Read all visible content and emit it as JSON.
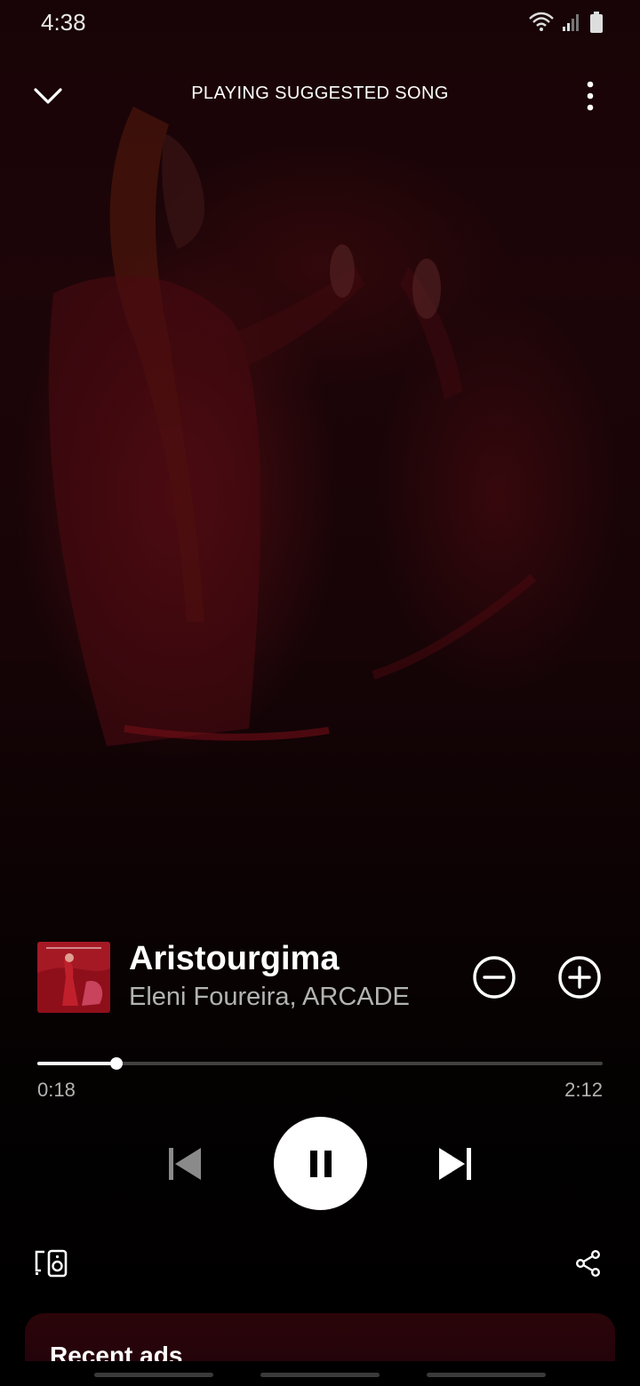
{
  "status_bar": {
    "time": "4:38",
    "icons": [
      "wifi-icon",
      "signal-icon",
      "battery-icon"
    ]
  },
  "header": {
    "title": "PLAYING SUGGESTED SONG",
    "collapse_icon": "chevron-down-icon",
    "more_icon": "more-vertical-icon"
  },
  "track": {
    "title": "Aristourgima",
    "artist": "Eleni Foureira, ARCADE"
  },
  "playback": {
    "elapsed": "0:18",
    "total": "2:12",
    "progress_fraction": 0.14,
    "is_playing": true
  },
  "controls": {
    "remove_icon": "minus-circle-icon",
    "add_icon": "plus-circle-icon",
    "prev_icon": "skip-previous-icon",
    "play_pause_icon": "pause-icon",
    "next_icon": "skip-next-icon",
    "devices_icon": "devices-icon",
    "share_icon": "share-icon"
  },
  "ads_card": {
    "title": "Recent ads"
  },
  "colors": {
    "background_top": "#1d0508",
    "card": "#2a0509",
    "secondary_text": "#b3b3b3"
  }
}
